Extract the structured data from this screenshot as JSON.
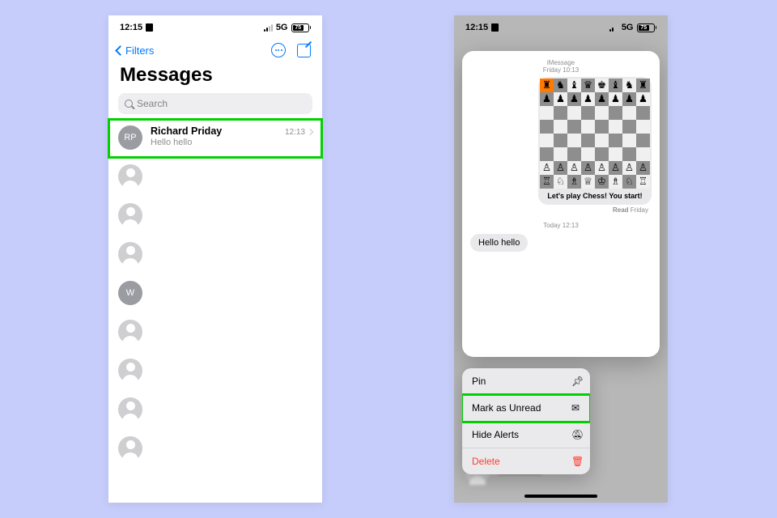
{
  "statusbar": {
    "time": "12:15",
    "network": "5G",
    "battery": "75"
  },
  "left": {
    "back_label": "Filters",
    "title": "Messages",
    "search_placeholder": "Search",
    "conversations": [
      {
        "avatar": "RP",
        "name": "Richard Priday",
        "time": "12:13",
        "preview": "Hello hello"
      },
      {
        "avatar": "",
        "name": "",
        "time": "",
        "preview": ""
      },
      {
        "avatar": "",
        "name": "",
        "time": "",
        "preview": ""
      },
      {
        "avatar": "",
        "name": "",
        "time": "",
        "preview": ""
      },
      {
        "avatar": "W",
        "name": "",
        "time": "",
        "preview": ""
      },
      {
        "avatar": "",
        "name": "",
        "time": "",
        "preview": ""
      },
      {
        "avatar": "",
        "name": "",
        "time": "",
        "preview": ""
      },
      {
        "avatar": "",
        "name": "",
        "time": "",
        "preview": ""
      },
      {
        "avatar": "",
        "name": "",
        "time": "",
        "preview": ""
      }
    ]
  },
  "right": {
    "imessage_label": "iMessage",
    "imessage_time": "Friday 10:13",
    "chess_caption": "Let's play Chess! You start!",
    "read_label": "Read",
    "read_time": " Friday",
    "today_label": "Today 12:13",
    "incoming_bubble": "Hello hello",
    "menu": {
      "pin": "Pin",
      "unread": "Mark as Unread",
      "hide": "Hide Alerts",
      "delete": "Delete"
    },
    "chess": {
      "black_back": [
        "♜",
        "♞",
        "♝",
        "♛",
        "♚",
        "♝",
        "♞",
        "♜"
      ],
      "black_pawn": "♟",
      "white_back": [
        "♖",
        "♘",
        "♗",
        "♕",
        "♔",
        "♗",
        "♘",
        "♖"
      ],
      "white_pawn": "♙"
    }
  }
}
